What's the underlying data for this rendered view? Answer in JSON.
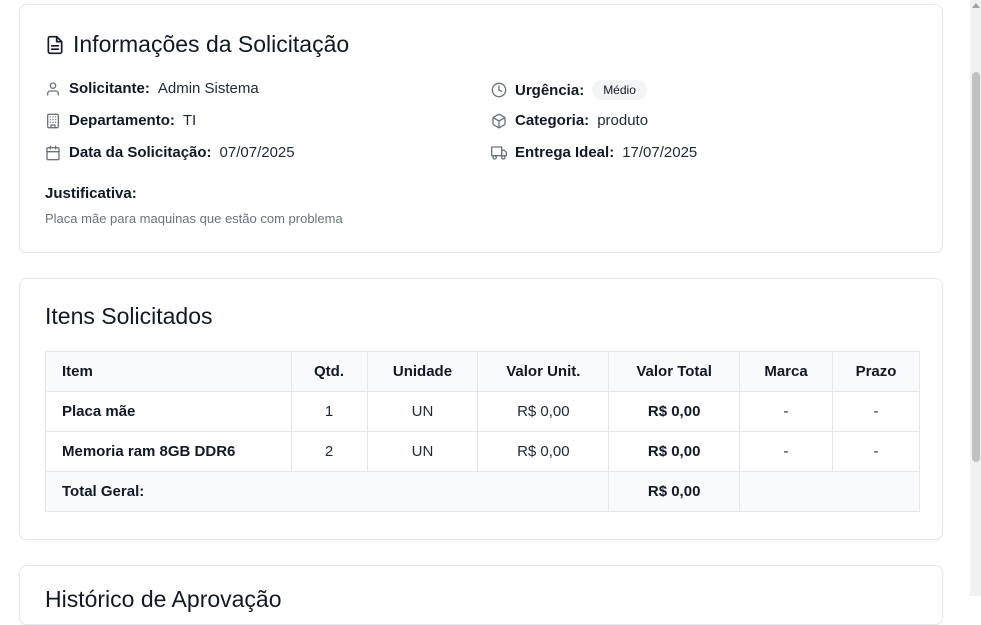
{
  "info": {
    "title": "Informações da Solicitação",
    "solicitante": {
      "label": "Solicitante:",
      "value": "Admin Sistema"
    },
    "departamento": {
      "label": "Departamento:",
      "value": "TI"
    },
    "data": {
      "label": "Data da Solicitação:",
      "value": "07/07/2025"
    },
    "urgencia": {
      "label": "Urgência:",
      "value": "Médio"
    },
    "categoria": {
      "label": "Categoria:",
      "value": "produto"
    },
    "entrega": {
      "label": "Entrega Ideal:",
      "value": "17/07/2025"
    },
    "justificativa": {
      "label": "Justificativa:",
      "value": "Placa mãe para maquinas que estão com problema"
    }
  },
  "items": {
    "title": "Itens Solicitados",
    "columns": [
      "Item",
      "Qtd.",
      "Unidade",
      "Valor Unit.",
      "Valor Total",
      "Marca",
      "Prazo"
    ],
    "rows": [
      {
        "item": "Placa mãe",
        "qtd": "1",
        "unidade": "UN",
        "valor_unit": "R$ 0,00",
        "valor_total": "R$ 0,00",
        "marca": "-",
        "prazo": "-"
      },
      {
        "item": "Memoria ram 8GB DDR6",
        "qtd": "2",
        "unidade": "UN",
        "valor_unit": "R$ 0,00",
        "valor_total": "R$ 0,00",
        "marca": "-",
        "prazo": "-"
      }
    ],
    "total_label": "Total Geral:",
    "total_value": "R$ 0,00"
  },
  "history": {
    "title": "Histórico de Aprovação"
  }
}
